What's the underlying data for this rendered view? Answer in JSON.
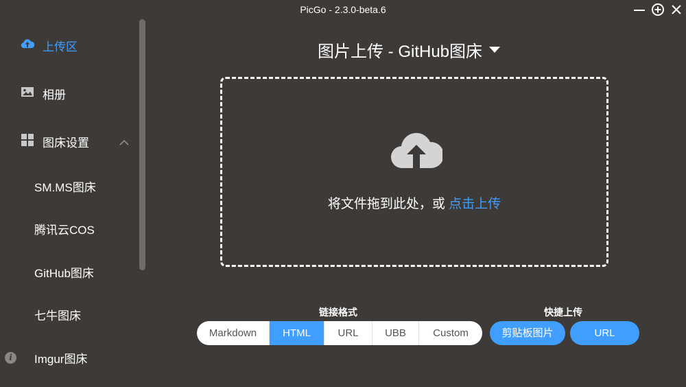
{
  "window": {
    "title": "PicGo - 2.3.0-beta.6"
  },
  "sidebar": {
    "items": [
      {
        "label": "上传区",
        "icon": "upload-cloud-icon",
        "active": true
      },
      {
        "label": "相册",
        "icon": "image-icon",
        "active": false
      },
      {
        "label": "图床设置",
        "icon": "grid-icon",
        "active": false,
        "expanded": true
      }
    ],
    "sub_items": [
      "SM.MS图床",
      "腾讯云COS",
      "GitHub图床",
      "七牛图床",
      "Imgur图床"
    ]
  },
  "main": {
    "title": "图片上传 - GitHub图床",
    "drop_text": "将文件拖到此处，或 ",
    "drop_link": "点击上传"
  },
  "link_format": {
    "label": "链接格式",
    "options": [
      "Markdown",
      "HTML",
      "URL",
      "UBB",
      "Custom"
    ],
    "selected": "HTML"
  },
  "quick_upload": {
    "label": "快捷上传",
    "clipboard": "剪贴板图片",
    "url": "URL"
  },
  "colors": {
    "accent": "#409eff",
    "background": "#3d3a37"
  }
}
